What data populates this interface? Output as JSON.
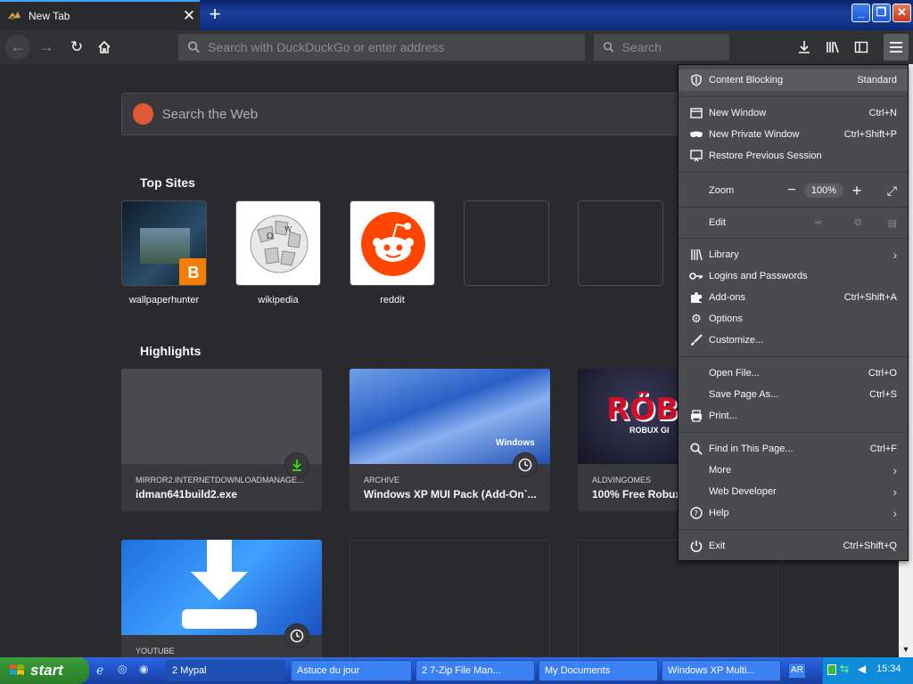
{
  "browser": {
    "tab_title": "New Tab",
    "url_placeholder": "Search with DuckDuckGo or enter address",
    "search_placeholder": "Search"
  },
  "newtab": {
    "web_search_placeholder": "Search the Web",
    "top_sites_title": "Top Sites",
    "top_sites": [
      {
        "label": "wallpaperhunter"
      },
      {
        "label": "wikipedia"
      },
      {
        "label": "reddit"
      }
    ],
    "highlights_title": "Highlights",
    "highlights": [
      {
        "source": "MIRROR2.INTERNETDOWNLOADMANAGE...",
        "title": "idman641build2.exe"
      },
      {
        "source": "ARCHIVE",
        "title": "Windows XP MUI Pack (Add-On`..."
      },
      {
        "source": "ALDVINGOMES",
        "title": "100% Free Robux"
      },
      {
        "source": "YOUTUBE",
        "title": ""
      }
    ],
    "roblox_text": "RÖB",
    "robux_text": "ROBUX GI",
    "windows_text": "Windows"
  },
  "menu": {
    "content_blocking": {
      "label": "Content Blocking",
      "value": "Standard"
    },
    "new_window": {
      "label": "New Window",
      "shortcut": "Ctrl+N"
    },
    "new_private_window": {
      "label": "New Private Window",
      "shortcut": "Ctrl+Shift+P"
    },
    "restore_session": {
      "label": "Restore Previous Session"
    },
    "zoom": {
      "label": "Zoom",
      "value": "100%"
    },
    "edit": {
      "label": "Edit"
    },
    "library": {
      "label": "Library"
    },
    "logins": {
      "label": "Logins and Passwords"
    },
    "addons": {
      "label": "Add-ons",
      "shortcut": "Ctrl+Shift+A"
    },
    "options": {
      "label": "Options"
    },
    "customize": {
      "label": "Customize..."
    },
    "open_file": {
      "label": "Open File...",
      "shortcut": "Ctrl+O"
    },
    "save_page": {
      "label": "Save Page As...",
      "shortcut": "Ctrl+S"
    },
    "print": {
      "label": "Print..."
    },
    "find": {
      "label": "Find in This Page...",
      "shortcut": "Ctrl+F"
    },
    "more": {
      "label": "More"
    },
    "web_developer": {
      "label": "Web Developer"
    },
    "help": {
      "label": "Help"
    },
    "exit": {
      "label": "Exit",
      "shortcut": "Ctrl+Shift+Q"
    }
  },
  "taskbar": {
    "start_label": "start",
    "tasks": [
      {
        "label": "2 Mypal"
      },
      {
        "label": "Astuce du jour"
      },
      {
        "label": "2 7-Zip File Man..."
      },
      {
        "label": "My Documents"
      },
      {
        "label": "Windows XP Multi..."
      }
    ],
    "language": "AR",
    "clock": "15:34"
  },
  "colors": {
    "brand_accent": "#45a1ff",
    "reddit": "#ff4500",
    "blogger": "#f57d00",
    "duckduckgo": "#de5833",
    "download_green": "#30e60b"
  }
}
